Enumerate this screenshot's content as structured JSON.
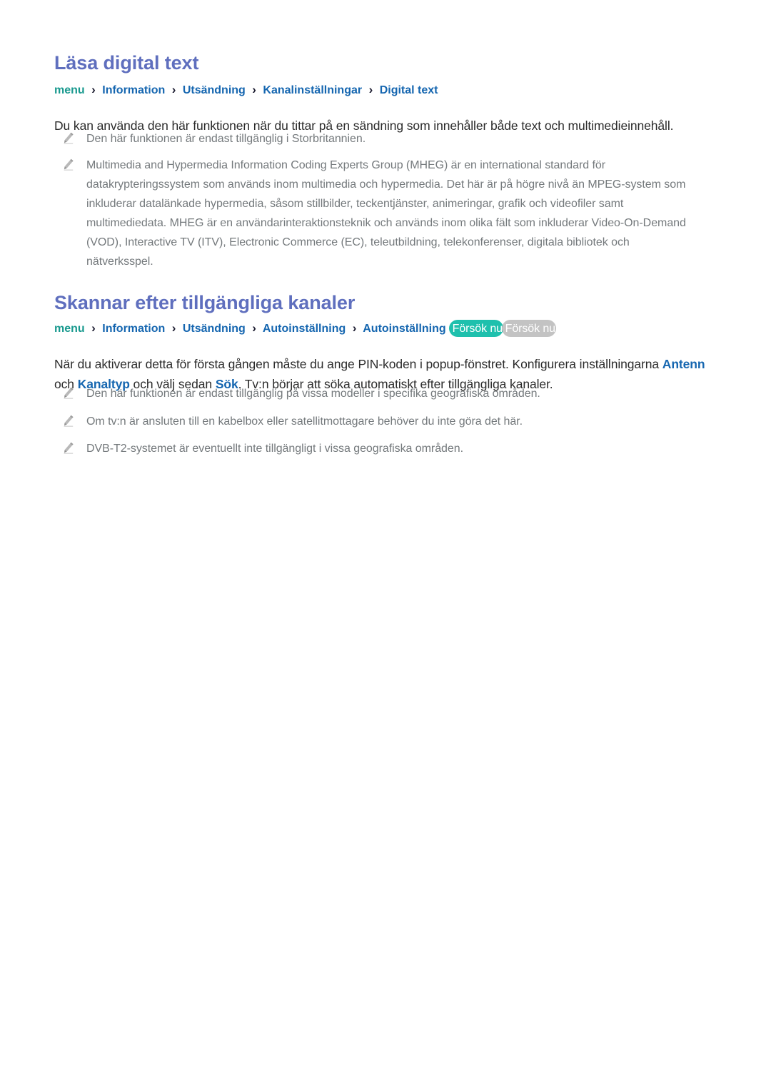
{
  "sections": [
    {
      "title": "Läsa digital text",
      "breadcrumb": {
        "root": "menu",
        "separator": "›",
        "items": [
          "Information",
          "Utsändning",
          "Kanalinställningar",
          "Digital text"
        ]
      },
      "paragraph": "Du kan använda den här funktionen när du tittar på en sändning som innehåller både text och multimedieinnehåll.",
      "notes": [
        "Den här funktionen är endast tillgänglig i Storbritannien.",
        "Multimedia and Hypermedia Information Coding Experts Group (MHEG) är en international standard för datakrypteringssystem som används inom multimedia och hypermedia. Det här är på högre nivå än MPEG-system som inkluderar datalänkade hypermedia, såsom stillbilder, teckentjänster, animeringar, grafik och videofiler samt multimediedata. MHEG är en användarinteraktionsteknik och används inom olika fält som inkluderar Video-On-Demand (VOD), Interactive TV (ITV), Electronic Commerce (EC), teleutbildning, telekonferenser, digitala bibliotek och nätverksspel."
      ]
    },
    {
      "title": "Skannar efter tillgängliga kanaler",
      "breadcrumb": {
        "root": "menu",
        "separator": "›",
        "items": [
          "Information",
          "Utsändning",
          "Autoinställning",
          "Autoinställning"
        ]
      },
      "badges": [
        {
          "label": "Försök nu",
          "color": "#1fc0ad",
          "state": "active"
        },
        {
          "label": "Försök nu",
          "color": "#c3c3c3",
          "state": "disabled"
        }
      ],
      "paragraph": {
        "part1": "När du aktiverar detta för första gången måste du ange PIN-koden i popup-fönstret. Konfigurera inställningarna ",
        "hl1": "Antenn",
        "part2": " och ",
        "hl2": "Kanaltyp",
        "part3": " och välj sedan ",
        "hl3": "Sök",
        "part4": ". Tv:n börjar att söka automatiskt efter tillgängliga kanaler."
      },
      "notes": [
        "Den här funktionen är endast tillgänglig på vissa modeller i specifika geografiska områden.",
        "Om tv:n är ansluten till en kabelbox eller satellitmottagare behöver du inte göra det här.",
        "DVB-T2-systemet är eventuellt inte tillgängligt i vissa geografiska områden."
      ]
    }
  ],
  "icons": {
    "note_bullet": "pencil-icon"
  },
  "colors": {
    "heading": "#5f6fbe",
    "breadcrumb_root": "#18998e",
    "breadcrumb_item": "#1566b0",
    "breadcrumb_separator": "#1b1b2f",
    "body_text": "#2b2b2b",
    "note_text": "#74797c",
    "badge_active": "#1fc0ad",
    "badge_disabled": "#c3c3c3",
    "page_background": "#ffffff"
  }
}
